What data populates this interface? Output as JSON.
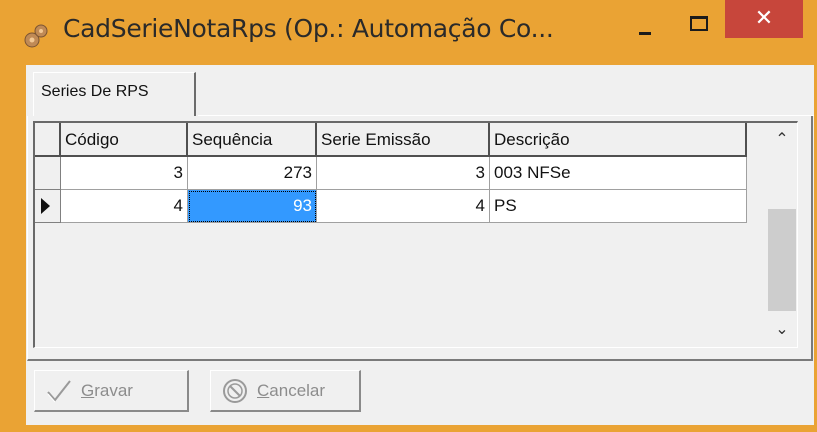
{
  "window": {
    "title": "CadSerieNotaRps (Op.: Automação Co...",
    "close_glyph": "✕"
  },
  "tabs": [
    {
      "label": "Series De RPS"
    }
  ],
  "grid": {
    "columns": [
      "Código",
      "Sequência",
      "Serie Emissão",
      "Descrição"
    ],
    "rows": [
      {
        "codigo": "3",
        "sequencia": "273",
        "serie_emissao": "3",
        "descricao": "003 NFSe"
      },
      {
        "codigo": "4",
        "sequencia": "93",
        "serie_emissao": "4",
        "descricao": "PS"
      }
    ],
    "scroll_up_glyph": "⌃",
    "scroll_down_glyph": "⌄"
  },
  "buttons": {
    "save": {
      "hotkey": "G",
      "rest": "ravar"
    },
    "cancel": {
      "hotkey": "C",
      "rest": "ancelar"
    }
  },
  "icons": {
    "app": "gear-icon",
    "save": "checkmark-icon",
    "cancel": "no-entry-icon"
  },
  "colors": {
    "title_bar": "#eaa334",
    "close": "#c7463b",
    "selection": "#3399ff"
  }
}
